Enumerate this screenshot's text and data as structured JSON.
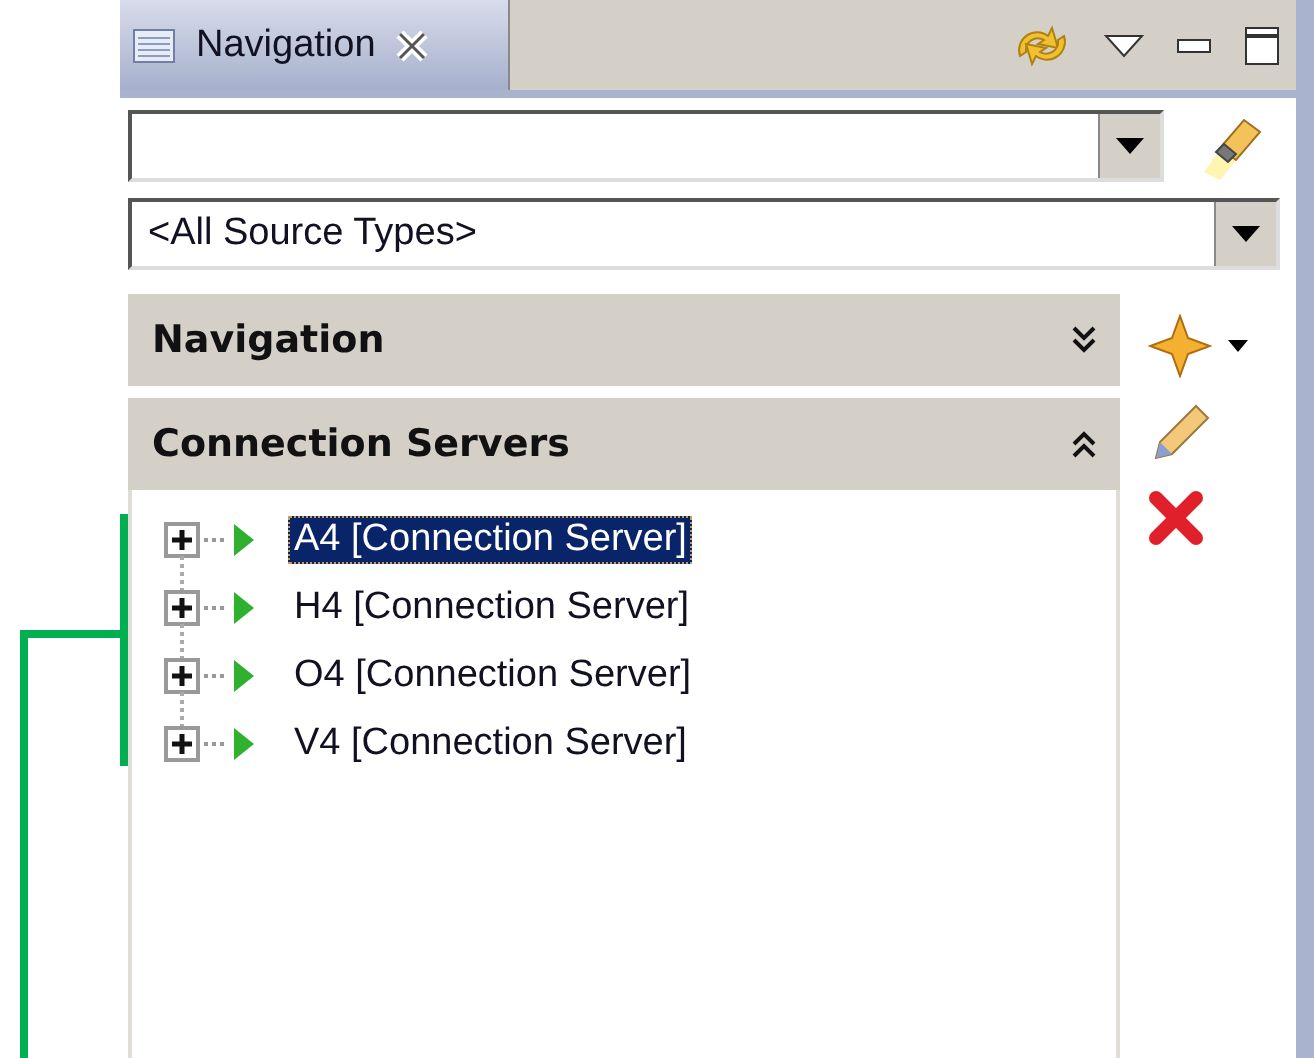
{
  "tab": {
    "title": "Navigation"
  },
  "source_type_combo": {
    "value": "<All Source Types>"
  },
  "sections": [
    {
      "title": "Navigation",
      "expanded": false
    },
    {
      "title": "Connection Servers",
      "expanded": true,
      "items": [
        {
          "label": "A4 [Connection Server]",
          "selected": true,
          "expanded": false
        },
        {
          "label": "H4 [Connection Server]",
          "selected": false,
          "expanded": false
        },
        {
          "label": "O4 [Connection Server]",
          "selected": false,
          "expanded": false
        },
        {
          "label": "V4 [Connection Server]",
          "selected": false,
          "expanded": false
        }
      ]
    }
  ]
}
